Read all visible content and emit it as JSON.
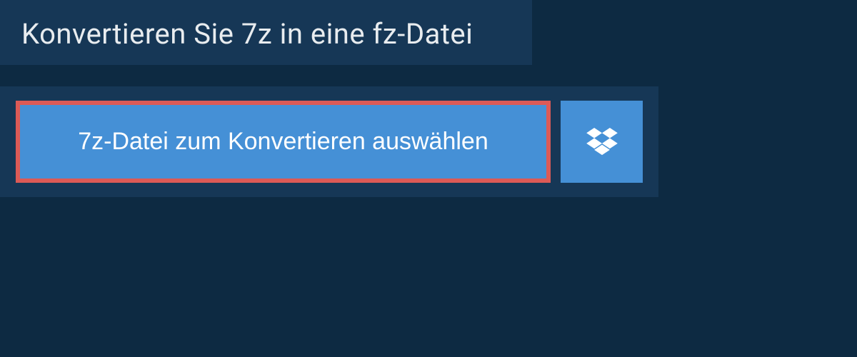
{
  "header": {
    "title": "Konvertieren Sie 7z in eine fz-Datei"
  },
  "converter": {
    "select_file_label": "7z-Datei zum Konvertieren auswählen"
  }
}
